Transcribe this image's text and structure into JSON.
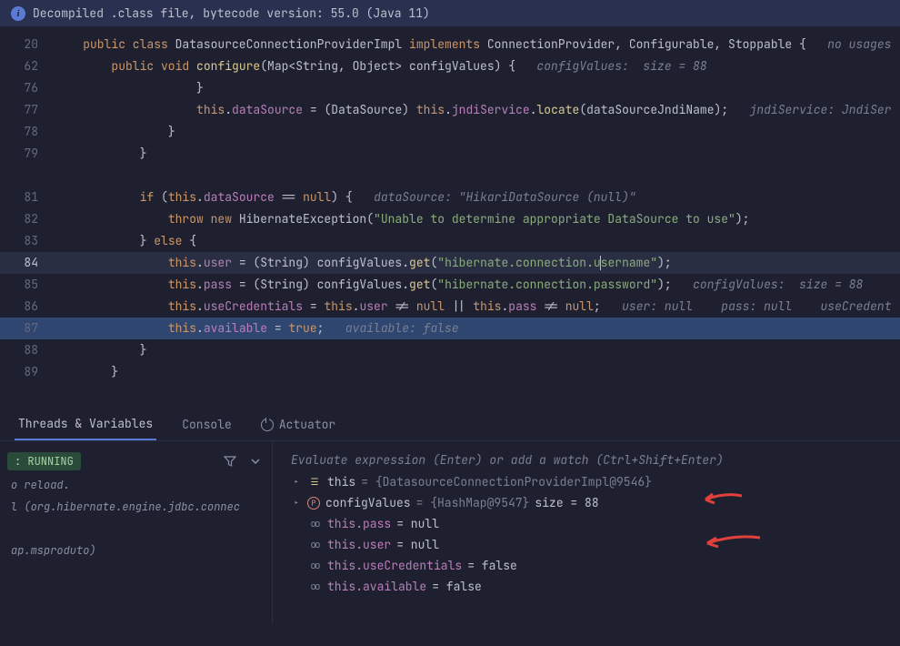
{
  "banner": {
    "text": "Decompiled .class file, bytecode version: 55.0 (Java 11)"
  },
  "lines": [
    {
      "num": "20"
    },
    {
      "num": "62"
    },
    {
      "num": "76"
    },
    {
      "num": "77"
    },
    {
      "num": "78"
    },
    {
      "num": "79"
    },
    {
      "num": ""
    },
    {
      "num": "81"
    },
    {
      "num": "82"
    },
    {
      "num": "83"
    },
    {
      "num": "84"
    },
    {
      "num": "85"
    },
    {
      "num": "86"
    },
    {
      "num": "87"
    },
    {
      "num": "88"
    },
    {
      "num": "89"
    }
  ],
  "code": {
    "l20_public": "public class ",
    "l20_class": "DatasourceConnectionProviderImpl ",
    "l20_implements": "implements ",
    "l20_ifaces": "ConnectionProvider, Configurable, Stoppable { ",
    "l20_usage": "no usages",
    "l62_public": "public void ",
    "l62_method": "configure",
    "l62_params": "(Map<String, Object> configValues) {   ",
    "l62_hint": "configValues:  size = 88",
    "l76_brace": "}",
    "l77_this": "this",
    "l77_dot": ".",
    "l77_ds": "dataSource",
    "l77_eq": " = (DataSource) ",
    "l77_this2": "this",
    "l77_jndi": "jndiService",
    "l77_locate": "locate",
    "l77_arg": "(dataSourceJndiName);   ",
    "l77_hint": "jndiService: JndiSer",
    "l78_brace": "}",
    "l79_brace": "}",
    "l81_if": "if ",
    "l81_cond": "(",
    "l81_this": "this",
    "l81_ds": "dataSource",
    "l81_null": " == ",
    "l81_nullkw": "null",
    "l81_close": ") {   ",
    "l81_hint": "dataSource: \"HikariDataSource (null)\"",
    "l82_throw": "throw new ",
    "l82_exc": "HibernateException(",
    "l82_str": "\"Unable to determine appropriate DataSource to use\"",
    "l82_end": ");",
    "l83_brace": "} ",
    "l83_else": "else",
    "l83_open": " {",
    "l84_this": "this",
    "l84_user": "user",
    "l84_eq": " = (String) configValues.",
    "l84_get": "get",
    "l84_open": "(",
    "l84_str1": "\"hibernate.connection.u",
    "l84_str2": "sername\"",
    "l84_end": ");",
    "l85_this": "this",
    "l85_pass": "pass",
    "l85_eq": " = (String) configValues.",
    "l85_get": "get",
    "l85_open": "(",
    "l85_str": "\"hibernate.connection.password\"",
    "l85_end": ");   ",
    "l85_hint": "configValues:  size = 88",
    "l86_this": "this",
    "l86_uc": "useCredentials",
    "l86_eq": " = ",
    "l86_this2": "this",
    "l86_user": "user",
    "l86_ne": " != ",
    "l86_null": "null",
    "l86_or": " || ",
    "l86_this3": "this",
    "l86_pass": "pass",
    "l86_ne2": " != ",
    "l86_null2": "null",
    "l86_end": ";   ",
    "l86_hint": "user: null    pass: null    useCredent",
    "l87_this": "this",
    "l87_avail": "available",
    "l87_eq": " = ",
    "l87_true": "true",
    "l87_end": ";   ",
    "l87_hint": "available: false",
    "l88_brace": "}",
    "l89_brace": "}"
  },
  "tabs": {
    "threads": "Threads & Variables",
    "console": "Console",
    "actuator": "Actuator"
  },
  "threads": {
    "running": ": RUNNING",
    "reload": "o reload.",
    "frame1": "l (org.hibernate.engine.jdbc.connec",
    "frame2": "ap.msproduto)"
  },
  "expr": {
    "placeholder": "Evaluate expression (Enter) or add a watch (Ctrl+Shift+Enter)"
  },
  "vars": {
    "this_label": "this",
    "this_val": " = {DatasourceConnectionProviderImpl@9546}",
    "cfg_label": "configValues",
    "cfg_val1": " = {HashMap@9547}",
    "cfg_val2": "  size = 88",
    "pass_label": "this.pass",
    "pass_val": " = null",
    "user_label": "this.user",
    "user_val": " = null",
    "uc_label": "this.useCredentials",
    "uc_val": " = false",
    "avail_label": "this.available",
    "avail_val": " = false"
  }
}
